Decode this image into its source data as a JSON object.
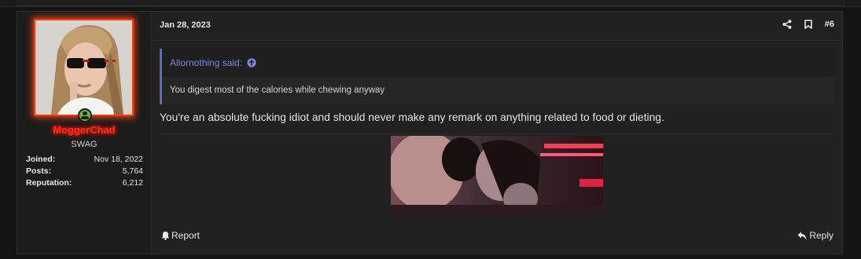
{
  "post": {
    "date": "Jan 28, 2023",
    "number": "#6",
    "body_text": "You're an absolute fucking idiot and should never make any remark on anything related to food or dieting.",
    "quote": {
      "author_line": "Allornothing said:",
      "text": "You digest most of the calories while chewing anyway"
    },
    "footer": {
      "report_label": "Report",
      "reply_label": "Reply"
    }
  },
  "user": {
    "name": "MoggerChad",
    "title": "SWAG",
    "stats": [
      {
        "label": "Joined:",
        "value": "Nov 18, 2022"
      },
      {
        "label": "Posts:",
        "value": "5,764"
      },
      {
        "label": "Reputation:",
        "value": "6,212"
      }
    ]
  },
  "icons": {
    "share": "share-icon",
    "bookmark": "bookmark-icon",
    "online": "online-user-icon",
    "quote_jump": "arrow-up-circle-icon",
    "report": "bell-icon",
    "reply": "reply-arrow-icon"
  },
  "colors": {
    "username": "#ff2a1a",
    "avatar_glow": "#ff3a0a",
    "quote_accent": "#5e6bc9",
    "quote_author": "#7b86e8",
    "online": "#63b33c"
  }
}
